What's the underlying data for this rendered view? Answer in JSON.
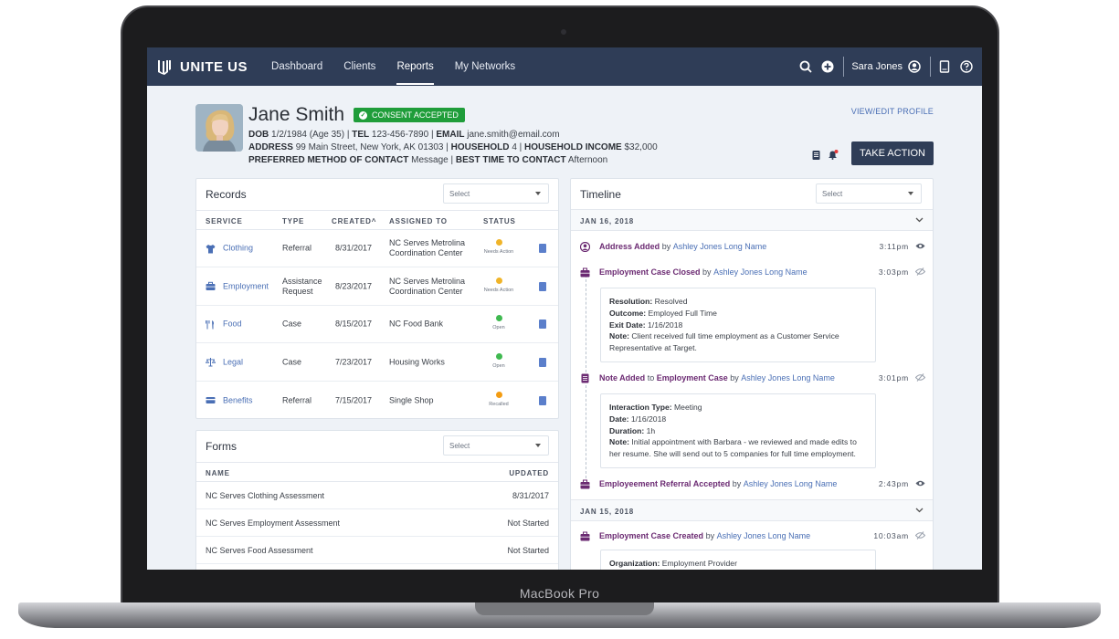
{
  "device": {
    "label": "MacBook Pro"
  },
  "nav": {
    "logo": "UNITE US",
    "links": [
      "Dashboard",
      "Clients",
      "Reports",
      "My Networks"
    ],
    "active": "Reports",
    "user": "Sara Jones"
  },
  "profile": {
    "name": "Jane Smith",
    "consent": "CONSENT ACCEPTED",
    "dob_label": "DOB",
    "dob": "1/2/1984 (Age 35)",
    "tel_label": "TEL",
    "tel": "123-456-7890",
    "email_label": "EMAIL",
    "email": "jane.smith@email.com",
    "address_label": "ADDRESS",
    "address": "99 Main Street, New York, AK 01303",
    "household_label": "HOUSEHOLD",
    "household": "4",
    "income_label": "HOUSEHOLD INCOME",
    "income": "$32,000",
    "contact_label": "PREFERRED METHOD OF CONTACT",
    "contact": "Message",
    "best_time_label": "BEST TIME TO CONTACT",
    "best_time": "Afternoon",
    "view_edit": "VIEW/EDIT PROFILE",
    "take_action": "TAKE ACTION"
  },
  "records": {
    "title": "Records",
    "select": "Select",
    "headers": {
      "service": "SERVICE",
      "type": "TYPE",
      "created": "CREATED",
      "assigned": "ASSIGNED TO",
      "status": "STATUS"
    },
    "rows": [
      {
        "service": "Clothing",
        "icon": "shirt-icon",
        "type": "Referral",
        "created": "8/31/2017",
        "assigned": "NC Serves Metrolina Coordination Center",
        "status": "Needs Action",
        "status_color": "#f0b429"
      },
      {
        "service": "Employment",
        "icon": "briefcase-icon",
        "type": "Assistance Request",
        "created": "8/23/2017",
        "assigned": "NC Serves Metrolina Coordination Center",
        "status": "Needs Action",
        "status_color": "#f0b429"
      },
      {
        "service": "Food",
        "icon": "utensils-icon",
        "type": "Case",
        "created": "8/15/2017",
        "assigned": "NC Food Bank",
        "status": "Open",
        "status_color": "#3fb950"
      },
      {
        "service": "Legal",
        "icon": "scales-icon",
        "type": "Case",
        "created": "7/23/2017",
        "assigned": "Housing Works",
        "status": "Open",
        "status_color": "#3fb950"
      },
      {
        "service": "Benefits",
        "icon": "card-icon",
        "type": "Referral",
        "created": "7/15/2017",
        "assigned": "Single Shop",
        "status": "Recalled",
        "status_color": "#f39c12"
      }
    ]
  },
  "forms": {
    "title": "Forms",
    "select": "Select",
    "headers": {
      "name": "NAME",
      "updated": "UPDATED"
    },
    "rows": [
      {
        "name": "NC Serves Clothing Assessment",
        "updated": "8/31/2017"
      },
      {
        "name": "NC Serves Employment Assessment",
        "updated": "Not Started"
      },
      {
        "name": "NC Serves Food Assessment",
        "updated": "Not Started"
      }
    ]
  },
  "timeline": {
    "title": "Timeline",
    "select": "Select",
    "dates": [
      "JAN 16, 2018",
      "JAN 15, 2018"
    ],
    "events": [
      {
        "title": "Address Added",
        "by": "by",
        "who": "Ashley Jones Long Name",
        "time": "3:11pm",
        "icon": "user-icon"
      },
      {
        "title": "Employment Case Closed",
        "by": "by",
        "who": "Ashley Jones Long Name",
        "time": "3:03pm",
        "icon": "briefcase-icon"
      },
      {
        "title": "Note Added",
        "to": "to",
        "target": "Employment Case",
        "by": "by",
        "who": "Ashley Jones Long Name",
        "time": "3:01pm",
        "icon": "note-icon"
      },
      {
        "title": "Employeement Referral Accepted",
        "by": "by",
        "who": "Ashley Jones Long Name",
        "time": "2:43pm",
        "icon": "briefcase-icon"
      },
      {
        "title": "Employment Case Created",
        "by": "by",
        "who": "Ashley Jones Long Name",
        "time": "10:03am",
        "icon": "briefcase-icon"
      }
    ],
    "card1": {
      "resolution_label": "Resolution:",
      "resolution": "Resolved",
      "outcome_label": "Outcome:",
      "outcome": "Employed Full Time",
      "exit_label": "Exit Date:",
      "exit": "1/16/2018",
      "note_label": "Note:",
      "note": "Client received full time employment as a Customer Service Representative at Target."
    },
    "card2": {
      "type_label": "Interaction Type:",
      "type": "Meeting",
      "date_label": "Date:",
      "date": "1/16/2018",
      "duration_label": "Duration:",
      "duration": "1h",
      "note_label": "Note:",
      "note": "Initial appointment with Barbara - we reviewed and made edits to her resume. She will send out to 5 companies for full time employment."
    },
    "card3": {
      "org_label": "Organization:",
      "org": "Employment Provider"
    }
  },
  "colors": {
    "navy": "#2f3d57",
    "consent_green": "#1f9d3a",
    "link_blue": "#4a6fb5",
    "event_purple": "#6b2a72"
  }
}
